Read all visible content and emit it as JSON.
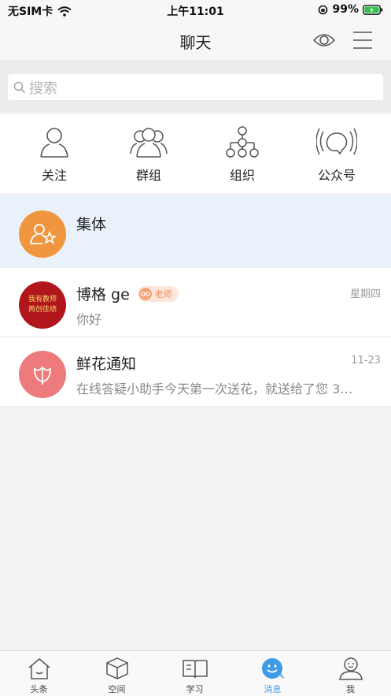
{
  "status_bar": {
    "carrier": "无SIM卡",
    "time": "上午11:01",
    "battery": "99%"
  },
  "nav": {
    "title": "聊天"
  },
  "search": {
    "placeholder": "搜索"
  },
  "quick_actions": [
    {
      "label": "关注",
      "icon": "person-icon"
    },
    {
      "label": "群组",
      "icon": "group-icon"
    },
    {
      "label": "组织",
      "icon": "org-tree-icon"
    },
    {
      "label": "公众号",
      "icon": "broadcast-icon"
    }
  ],
  "conversations": [
    {
      "name": "集体",
      "preview": "",
      "time": "",
      "avatar_color": "#f0963f",
      "highlighted": true
    },
    {
      "name": "博格 ge",
      "badge": "老师",
      "preview": "你好",
      "time": "星期四",
      "avatar_text": "我有教师 再创佳绩",
      "avatar_color": "#b1161c"
    },
    {
      "name": "鲜花通知",
      "preview": "在线答疑小助手今天第一次送花，就送给了您 3…",
      "time": "11-23",
      "avatar_color": "#ee7b7b"
    }
  ],
  "tabs": [
    {
      "label": "头条",
      "icon": "house-icon",
      "active": false
    },
    {
      "label": "空间",
      "icon": "cube-icon",
      "active": false
    },
    {
      "label": "学习",
      "icon": "book-icon",
      "active": false
    },
    {
      "label": "消息",
      "icon": "chat-face-icon",
      "active": true
    },
    {
      "label": "我",
      "icon": "profile-icon",
      "active": false
    }
  ],
  "colors": {
    "accent": "#3f9be8",
    "highlight_row": "#e9f2fb"
  }
}
